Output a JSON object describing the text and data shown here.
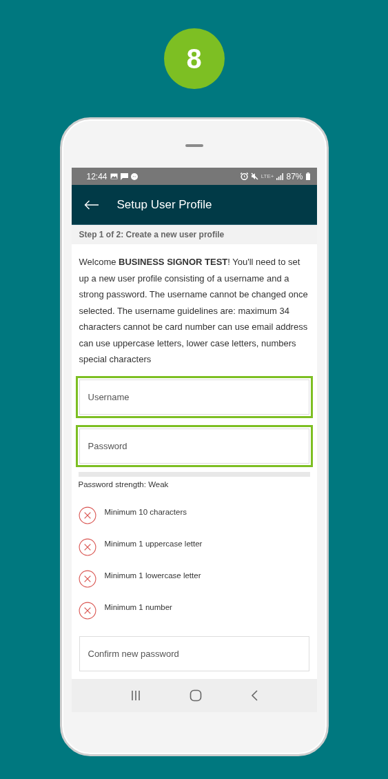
{
  "step_badge": "8",
  "status_bar": {
    "time": "12:44",
    "network": "LTE+",
    "battery": "87%"
  },
  "app_bar": {
    "title": "Setup User Profile"
  },
  "step_banner": "Step 1 of 2: Create a new user profile",
  "intro": "Welcome **BUSINESS SIGNOR TEST**! You'll need to set up a new user profile consisting of a username and a strong password. The username cannot be changed once selected. The username guidelines are: maximum 34 characters cannot be card number can use email address can use uppercase letters, lower case letters, numbers special characters",
  "fields": [
    {
      "placeholder": "Username",
      "highlighted": true
    },
    {
      "placeholder": "Password",
      "highlighted": true
    }
  ],
  "strength": {
    "level": 0,
    "label": "Password strength: Weak"
  },
  "requirements": [
    {
      "text": "Minimum 10 characters",
      "met": false
    },
    {
      "text": "Minimum 1 uppercase letter",
      "met": false
    },
    {
      "text": "Minimum 1 lowercase letter",
      "met": false
    },
    {
      "text": "Minimum 1 number",
      "met": false
    }
  ],
  "confirm_field": {
    "placeholder": "Confirm new password",
    "highlighted": false
  }
}
